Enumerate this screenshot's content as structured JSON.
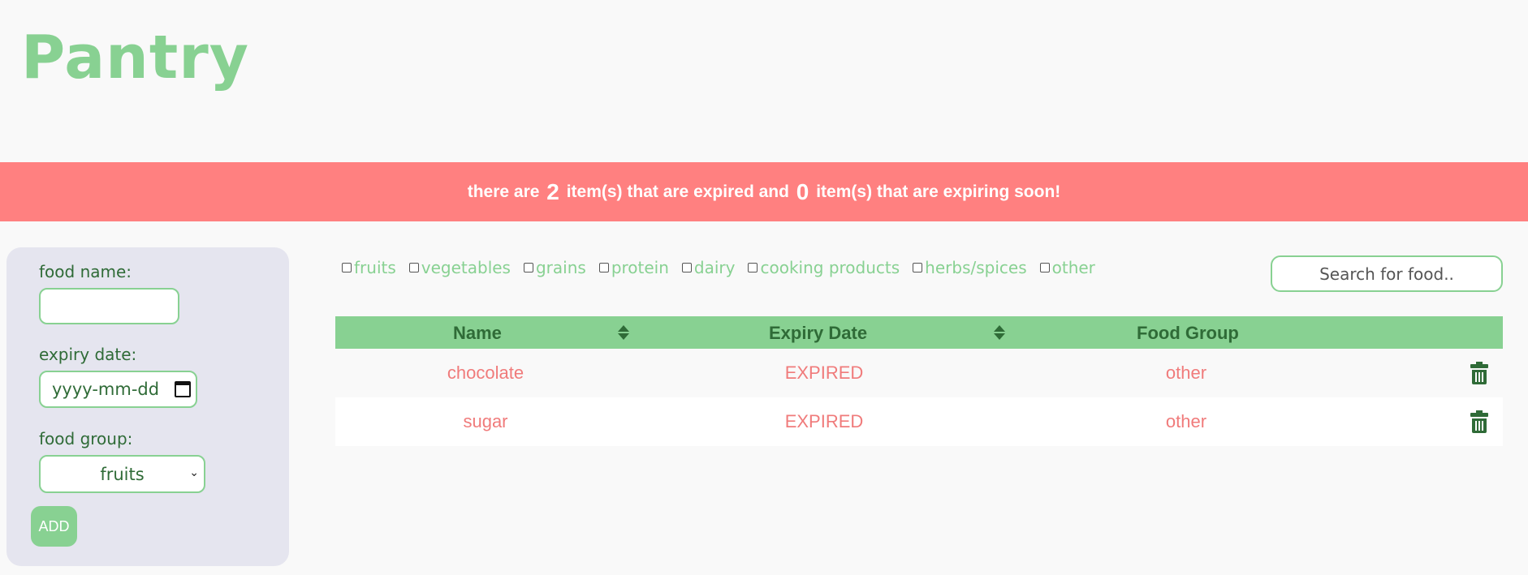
{
  "app": {
    "title": "Pantry"
  },
  "banner": {
    "prefix": "there are",
    "expired_count": "2",
    "middle": "item(s) that are expired and",
    "expiring_count": "0",
    "suffix": "item(s) that are expiring soon!",
    "color": "#ff8080"
  },
  "form": {
    "food_name_label": "food name:",
    "food_name_value": "",
    "expiry_label": "expiry date:",
    "expiry_placeholder": "yyyy-mm-dd",
    "group_label": "food group:",
    "group_value": "fruits",
    "add_label": "ADD"
  },
  "filters": [
    "fruits",
    "vegetables",
    "grains",
    "protein",
    "dairy",
    "cooking products",
    "herbs/spices",
    "other"
  ],
  "search": {
    "placeholder": "Search for food.."
  },
  "table": {
    "headers": {
      "name": "Name",
      "expiry": "Expiry Date",
      "group": "Food Group"
    },
    "rows": [
      {
        "name": "chocolate",
        "expiry": "EXPIRED",
        "group": "other"
      },
      {
        "name": "sugar",
        "expiry": "EXPIRED",
        "group": "other"
      }
    ]
  },
  "colors": {
    "accent": "#88d192",
    "expired_text": "#f07b7b",
    "dark_green": "#2f6b37"
  },
  "icons": {
    "calendar": "calendar-icon",
    "trash": "trash-icon",
    "sort": "sort-icon"
  }
}
